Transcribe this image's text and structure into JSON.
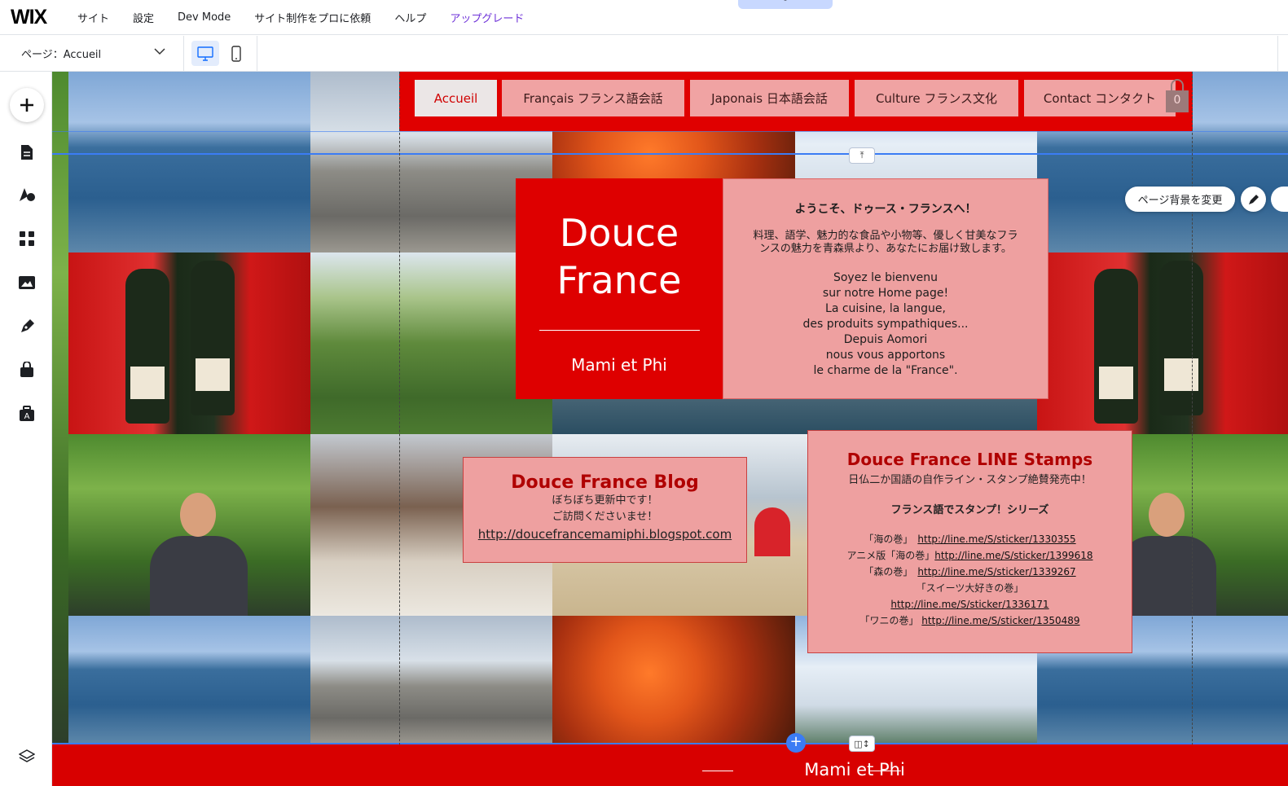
{
  "app": {
    "logo": "WIX",
    "menu": [
      "サイト",
      "設定",
      "Dev Mode",
      "サイト制作をプロに依頼",
      "ヘルプ"
    ],
    "upgrade": "アップグレード",
    "collapse": "˄"
  },
  "toolbar": {
    "page_label": "ページ：Accueil",
    "device_desktop": "desktop-icon",
    "device_mobile": "mobile-icon"
  },
  "sidebar": {
    "icons": [
      "add-icon",
      "pages-icon",
      "design-icon",
      "apps-icon",
      "media-icon",
      "blog-icon",
      "business-icon",
      "portfolio-icon",
      "layers-icon"
    ]
  },
  "site": {
    "nav": [
      "Accueil",
      "Français フランス語会話",
      "Japonais 日本語会話",
      "Culture フランス文化",
      "Contact コンタクト"
    ],
    "cart_count": "0",
    "hero_title_1": "Douce",
    "hero_title_2": "France",
    "hero_sub": "Mami et Phi",
    "welcome_heading": "ようこそ、ドゥース・フランスへ！",
    "welcome_jp_1": "料理、語学、魅力的な食品や小物等、優しく甘美なフラ",
    "welcome_jp_2": "ンスの魅力を青森県より、あなたにお届け致します。",
    "welcome_fr": [
      "Soyez le bienvenu",
      "sur notre Home page!",
      "La cuisine, la langue,",
      "des produits sympathiques...",
      "Depuis Aomori",
      "nous vous apportons",
      "le charme de la \"France\"."
    ],
    "blog_title": "Douce France Blog",
    "blog_line_1": "ぼちぼち更新中です！",
    "blog_line_2": "ご訪問くださいませ！",
    "blog_link": "http://doucefrancemamiphi.blogspot.com",
    "stamps_title": "Douce France LINE Stamps",
    "stamps_sub": "日仏二か国語の自作ライン・スタンプ絶賛発売中！",
    "stamps_series": "フランス語でスタンプ！シリーズ",
    "stamps": [
      {
        "name": "「海の巻」　",
        "link": "http://line.me/S/sticker/1330355"
      },
      {
        "name": "アニメ版「海の巻」",
        "link": "http://line.me/S/sticker/1399618"
      },
      {
        "name": "「森の巻」　",
        "link": "http://line.me/S/sticker/1339267"
      },
      {
        "name": "「スイーツ大好きの巻」",
        "link": ""
      },
      {
        "name": "",
        "link": "http://line.me/S/sticker/1336171"
      },
      {
        "name": "「ワニの巻」 ",
        "link": "http://line.me/S/sticker/1350489"
      }
    ],
    "footer_text": "Mami et Phi"
  },
  "editor": {
    "change_bg": "ページ背景を変更",
    "plus": "+",
    "anchor_top": "⤒",
    "anchor_bottom": "◫↕"
  },
  "colors": {
    "site_red": "#e00000",
    "pink_box": "#eea0a0",
    "selection_blue": "#3b7cf4",
    "upgrade_purple": "#6e32d8"
  }
}
